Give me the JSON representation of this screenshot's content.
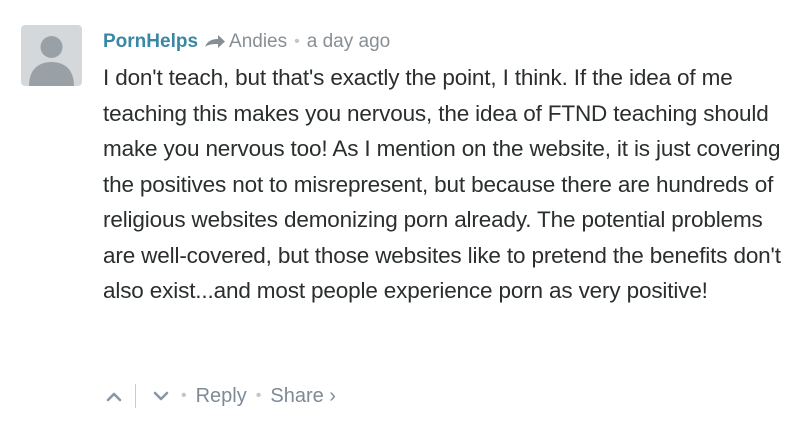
{
  "comment": {
    "author": "PornHelps",
    "reply_to": "Andies",
    "separator": "•",
    "timestamp": "a day ago",
    "text": "I don't teach, but that's exactly the point, I think. If the idea of me teaching this makes you nervous, the idea of FTND teaching should make you nervous too! As I mention on the website, it is just covering the positives not to misrepresent, but because there are hundreds of religious websites demonizing porn already. The potential problems are well-covered, but those websites like to pretend the benefits don't also exist...and most people experience porn as very positive!",
    "avatar_icon": "default-avatar-icon",
    "reply_indicator_icon": "reply-arrow-icon"
  },
  "footer": {
    "upvote_icon": "chevron-up-icon",
    "downvote_icon": "chevron-down-icon",
    "separator": "•",
    "reply_label": "Reply",
    "share_label": "Share ›"
  },
  "colors": {
    "author": "#3a87a4",
    "meta": "#888f94",
    "text": "#2a2e2e",
    "avatar_bg": "#d5d8da",
    "avatar_fg": "#9aa1a6"
  }
}
